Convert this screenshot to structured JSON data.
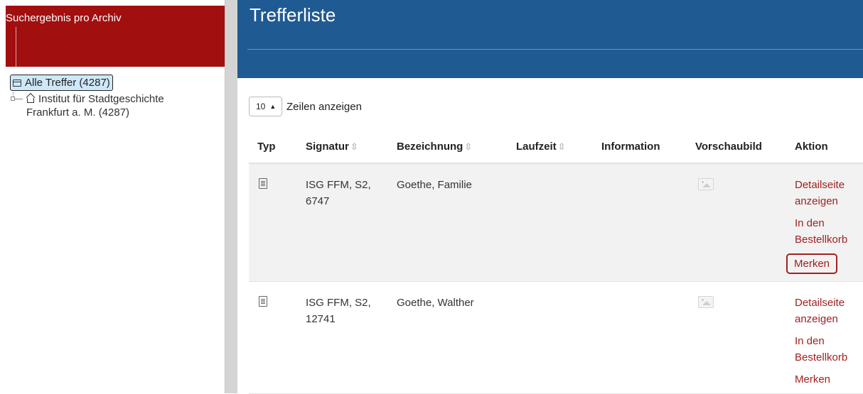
{
  "sidebar": {
    "title": "Suchergebnis pro Archiv",
    "tree": {
      "root_label": "Alle Treffer (4287)",
      "child_label_line1": "Institut für Stadtgeschichte",
      "child_label_line2": "Frankfurt a. M. (4287)"
    }
  },
  "main": {
    "title": "Trefferliste",
    "rows_select": {
      "value": "10",
      "label": "Zeilen anzeigen"
    },
    "columns": [
      "Typ",
      "Signatur",
      "Bezeichnung",
      "Laufzeit",
      "Information",
      "Vorschaubild",
      "Aktion"
    ],
    "rows": [
      {
        "typ_icon": "document-icon",
        "signatur_line1": "ISG FFM, S2,",
        "signatur_line2": "6747",
        "bezeichnung": "Goethe, Familie",
        "laufzeit": "",
        "information": "",
        "vorschau_icon": "image-placeholder-icon",
        "actions": {
          "detail_line1": "Detailseite",
          "detail_line2": "anzeigen",
          "basket_line1": "In den",
          "basket_line2": "Bestellkorb",
          "remember": "Merken"
        }
      },
      {
        "typ_icon": "document-icon",
        "signatur_line1": "ISG FFM, S2,",
        "signatur_line2": "12741",
        "bezeichnung": "Goethe, Walther",
        "laufzeit": "",
        "information": "",
        "vorschau_icon": "image-placeholder-icon",
        "actions": {
          "detail_line1": "Detailseite",
          "detail_line2": "anzeigen",
          "basket_line1": "In den",
          "basket_line2": "Bestellkorb",
          "remember": "Merken"
        }
      }
    ]
  },
  "colors": {
    "sidebar_header": "#a20f0f",
    "banner": "#1f5a93",
    "action_link": "#a32020",
    "selected_tree_item": "#cfe8f9"
  }
}
